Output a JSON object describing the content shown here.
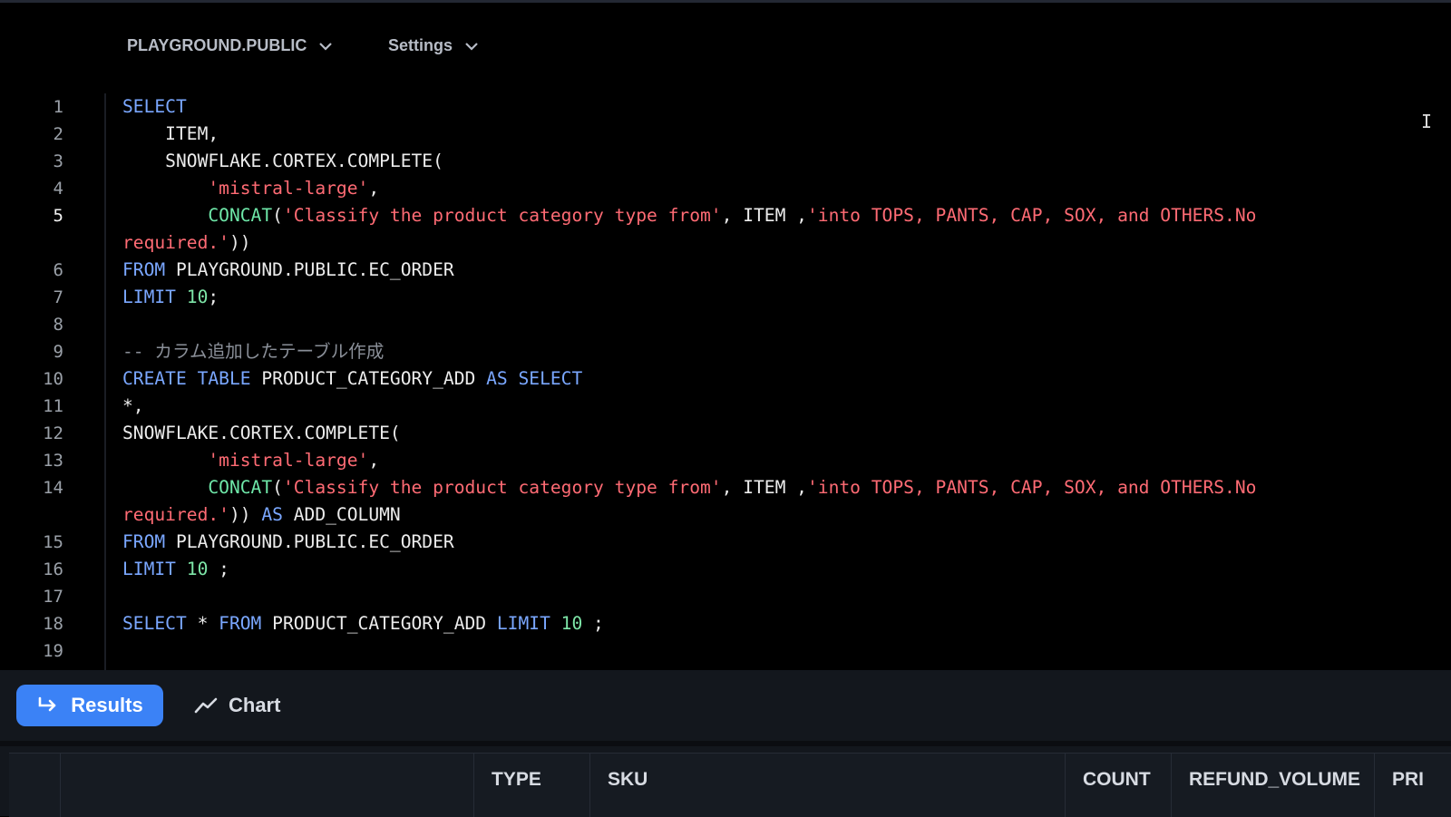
{
  "toolbar": {
    "database": "PLAYGROUND.PUBLIC",
    "settings": "Settings"
  },
  "editor": {
    "active_line": 5,
    "lines": [
      {
        "n": "1",
        "segs": [
          [
            "kw",
            "SELECT"
          ]
        ]
      },
      {
        "n": "2",
        "segs": [
          [
            "",
            "    ITEM,"
          ]
        ]
      },
      {
        "n": "3",
        "segs": [
          [
            "",
            "    SNOWFLAKE.CORTEX.COMPLETE("
          ]
        ]
      },
      {
        "n": "4",
        "segs": [
          [
            "",
            "        "
          ],
          [
            "str",
            "'mistral-large'"
          ],
          [
            "",
            ","
          ]
        ]
      },
      {
        "n": "5",
        "segs": [
          [
            "",
            "        "
          ],
          [
            "fn",
            "CONCAT"
          ],
          [
            "",
            "("
          ],
          [
            "str",
            "'Classify the product category type from'"
          ],
          [
            "",
            ", ITEM ,"
          ],
          [
            "str",
            "'into TOPS, PANTS, CAP, SOX, and OTHERS.No"
          ]
        ]
      },
      {
        "n": "",
        "segs": [
          [
            "str",
            "required.'"
          ],
          [
            "",
            "))"
          ]
        ]
      },
      {
        "n": "6",
        "segs": [
          [
            "kw",
            "FROM"
          ],
          [
            "",
            " PLAYGROUND.PUBLIC.EC_ORDER"
          ]
        ]
      },
      {
        "n": "7",
        "segs": [
          [
            "kw",
            "LIMIT"
          ],
          [
            "",
            " "
          ],
          [
            "num",
            "10"
          ],
          [
            "",
            ";"
          ]
        ]
      },
      {
        "n": "8",
        "segs": []
      },
      {
        "n": "9",
        "segs": [
          [
            "cmt",
            "-- カラム追加したテーブル作成"
          ]
        ]
      },
      {
        "n": "10",
        "segs": [
          [
            "kw",
            "CREATE TABLE"
          ],
          [
            "",
            " PRODUCT_CATEGORY_ADD "
          ],
          [
            "kw",
            "AS SELECT"
          ]
        ]
      },
      {
        "n": "11",
        "segs": [
          [
            "",
            "*,"
          ]
        ]
      },
      {
        "n": "12",
        "segs": [
          [
            "",
            "SNOWFLAKE.CORTEX.COMPLETE("
          ]
        ]
      },
      {
        "n": "13",
        "segs": [
          [
            "",
            "        "
          ],
          [
            "str",
            "'mistral-large'"
          ],
          [
            "",
            ","
          ]
        ]
      },
      {
        "n": "14",
        "segs": [
          [
            "",
            "        "
          ],
          [
            "fn",
            "CONCAT"
          ],
          [
            "",
            "("
          ],
          [
            "str",
            "'Classify the product category type from'"
          ],
          [
            "",
            ", ITEM ,"
          ],
          [
            "str",
            "'into TOPS, PANTS, CAP, SOX, and OTHERS.No"
          ]
        ]
      },
      {
        "n": "",
        "segs": [
          [
            "str",
            "required.'"
          ],
          [
            "",
            ")) "
          ],
          [
            "kw",
            "AS"
          ],
          [
            "",
            " ADD_COLUMN"
          ]
        ]
      },
      {
        "n": "15",
        "segs": [
          [
            "kw",
            "FROM"
          ],
          [
            "",
            " PLAYGROUND.PUBLIC.EC_ORDER"
          ]
        ]
      },
      {
        "n": "16",
        "segs": [
          [
            "kw",
            "LIMIT"
          ],
          [
            "",
            " "
          ],
          [
            "num",
            "10"
          ],
          [
            "",
            " ;"
          ]
        ]
      },
      {
        "n": "17",
        "segs": []
      },
      {
        "n": "18",
        "segs": [
          [
            "kw",
            "SELECT"
          ],
          [
            "",
            " * "
          ],
          [
            "kw",
            "FROM"
          ],
          [
            "",
            " PRODUCT_CATEGORY_ADD "
          ],
          [
            "kw",
            "LIMIT"
          ],
          [
            "",
            " "
          ],
          [
            "num",
            "10"
          ],
          [
            "",
            " ;"
          ]
        ]
      },
      {
        "n": "19",
        "segs": []
      }
    ]
  },
  "results": {
    "tabs": {
      "results": "Results",
      "chart": "Chart"
    },
    "columns": [
      "",
      "",
      "TYPE",
      "SKU",
      "COUNT",
      "REFUND_VOLUME",
      "PRI"
    ]
  }
}
